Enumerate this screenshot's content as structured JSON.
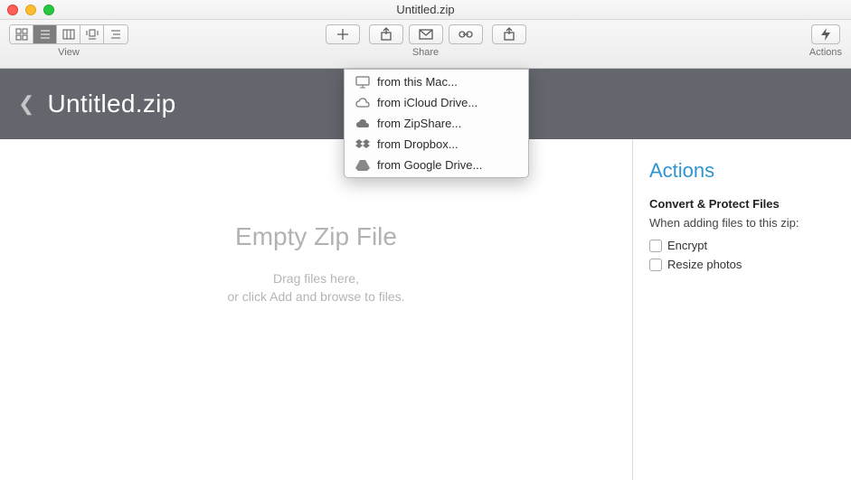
{
  "window": {
    "title": "Untitled.zip"
  },
  "toolbar": {
    "view_label": "View",
    "share_label": "Share",
    "actions_label": "Actions"
  },
  "header": {
    "title": "Untitled.zip"
  },
  "content": {
    "empty_title": "Empty Zip File",
    "line1": "Drag files here,",
    "line2": "or click Add and browse to files."
  },
  "sidebar": {
    "title": "Actions",
    "section_title": "Convert & Protect Files",
    "desc": "When adding files to this zip:",
    "opt_encrypt": "Encrypt",
    "opt_resize": "Resize photos"
  },
  "dropdown": {
    "items": [
      {
        "label": "from this Mac..."
      },
      {
        "label": "from iCloud Drive..."
      },
      {
        "label": "from ZipShare..."
      },
      {
        "label": "from Dropbox..."
      },
      {
        "label": "from Google Drive..."
      }
    ]
  }
}
